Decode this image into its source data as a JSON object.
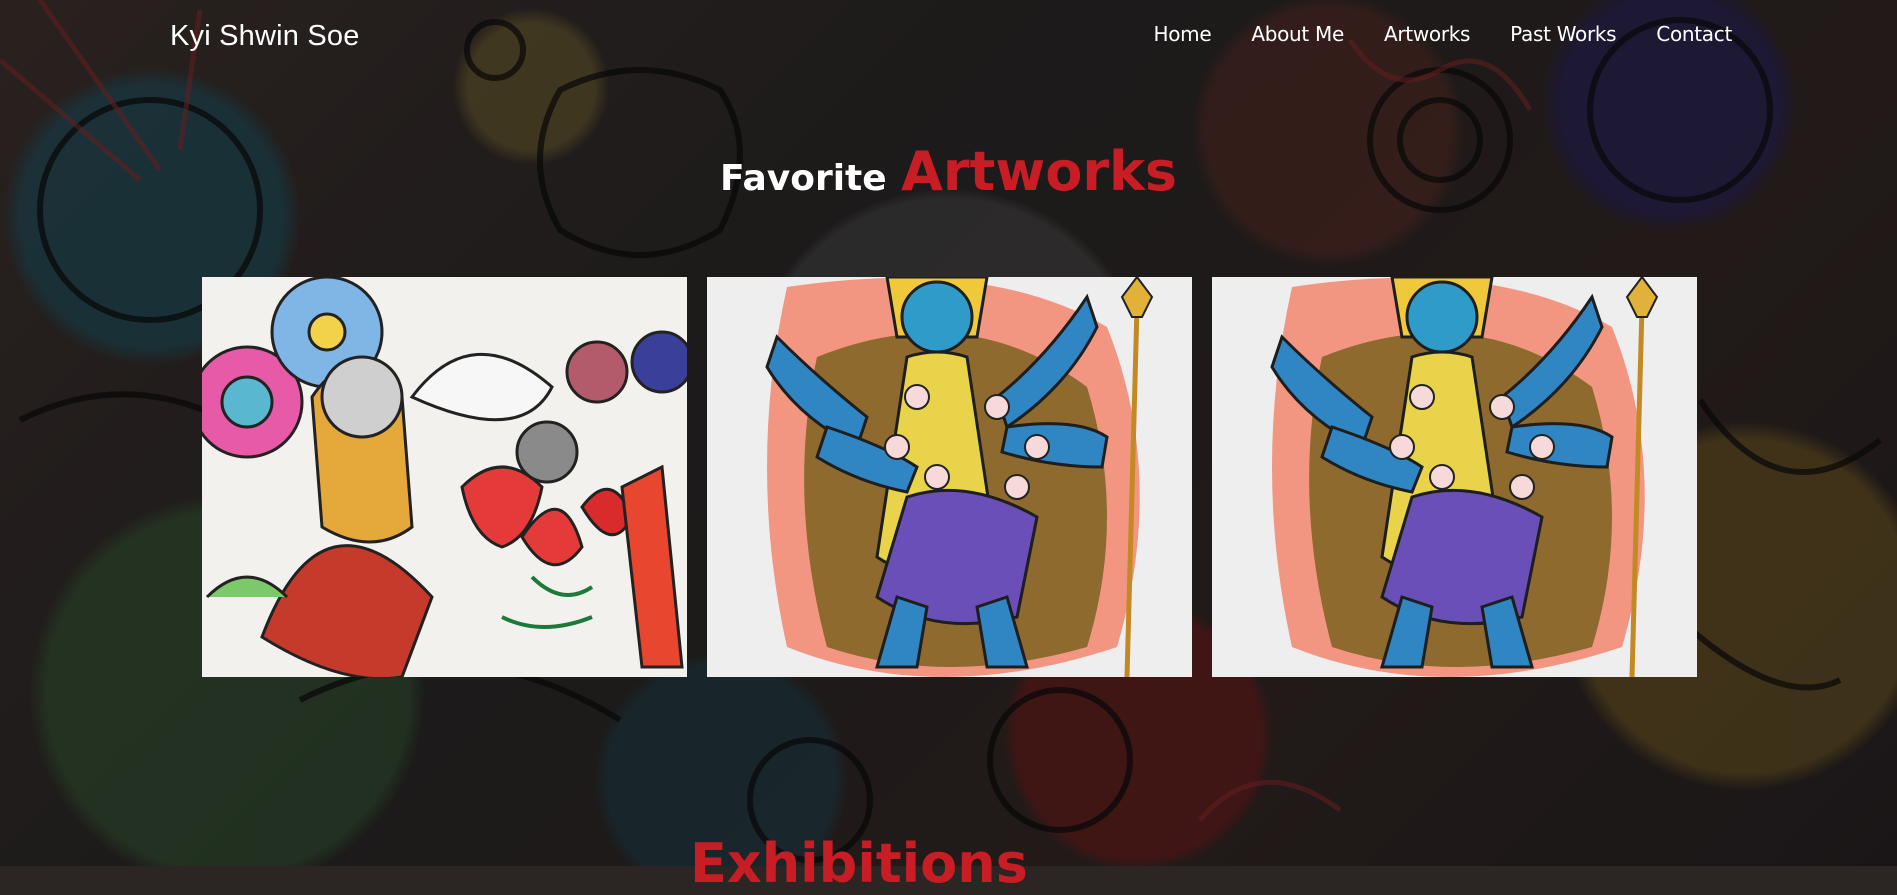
{
  "site": {
    "title": "Kyi Shwin Soe"
  },
  "nav": {
    "items": [
      {
        "label": "Home"
      },
      {
        "label": "About Me"
      },
      {
        "label": "Artworks"
      },
      {
        "label": "Past Works"
      },
      {
        "label": "Contact"
      }
    ]
  },
  "favorites": {
    "title_small": "Favorite",
    "title_big": "Artworks",
    "artworks": [
      {
        "name": "flower-figures-painting"
      },
      {
        "name": "kali-painting"
      },
      {
        "name": "kali-painting"
      }
    ]
  },
  "exhibitions": {
    "title_big": "Exhibitions",
    "title_small": ""
  },
  "colors": {
    "accent": "#c91d25",
    "text": "#ffffff"
  }
}
